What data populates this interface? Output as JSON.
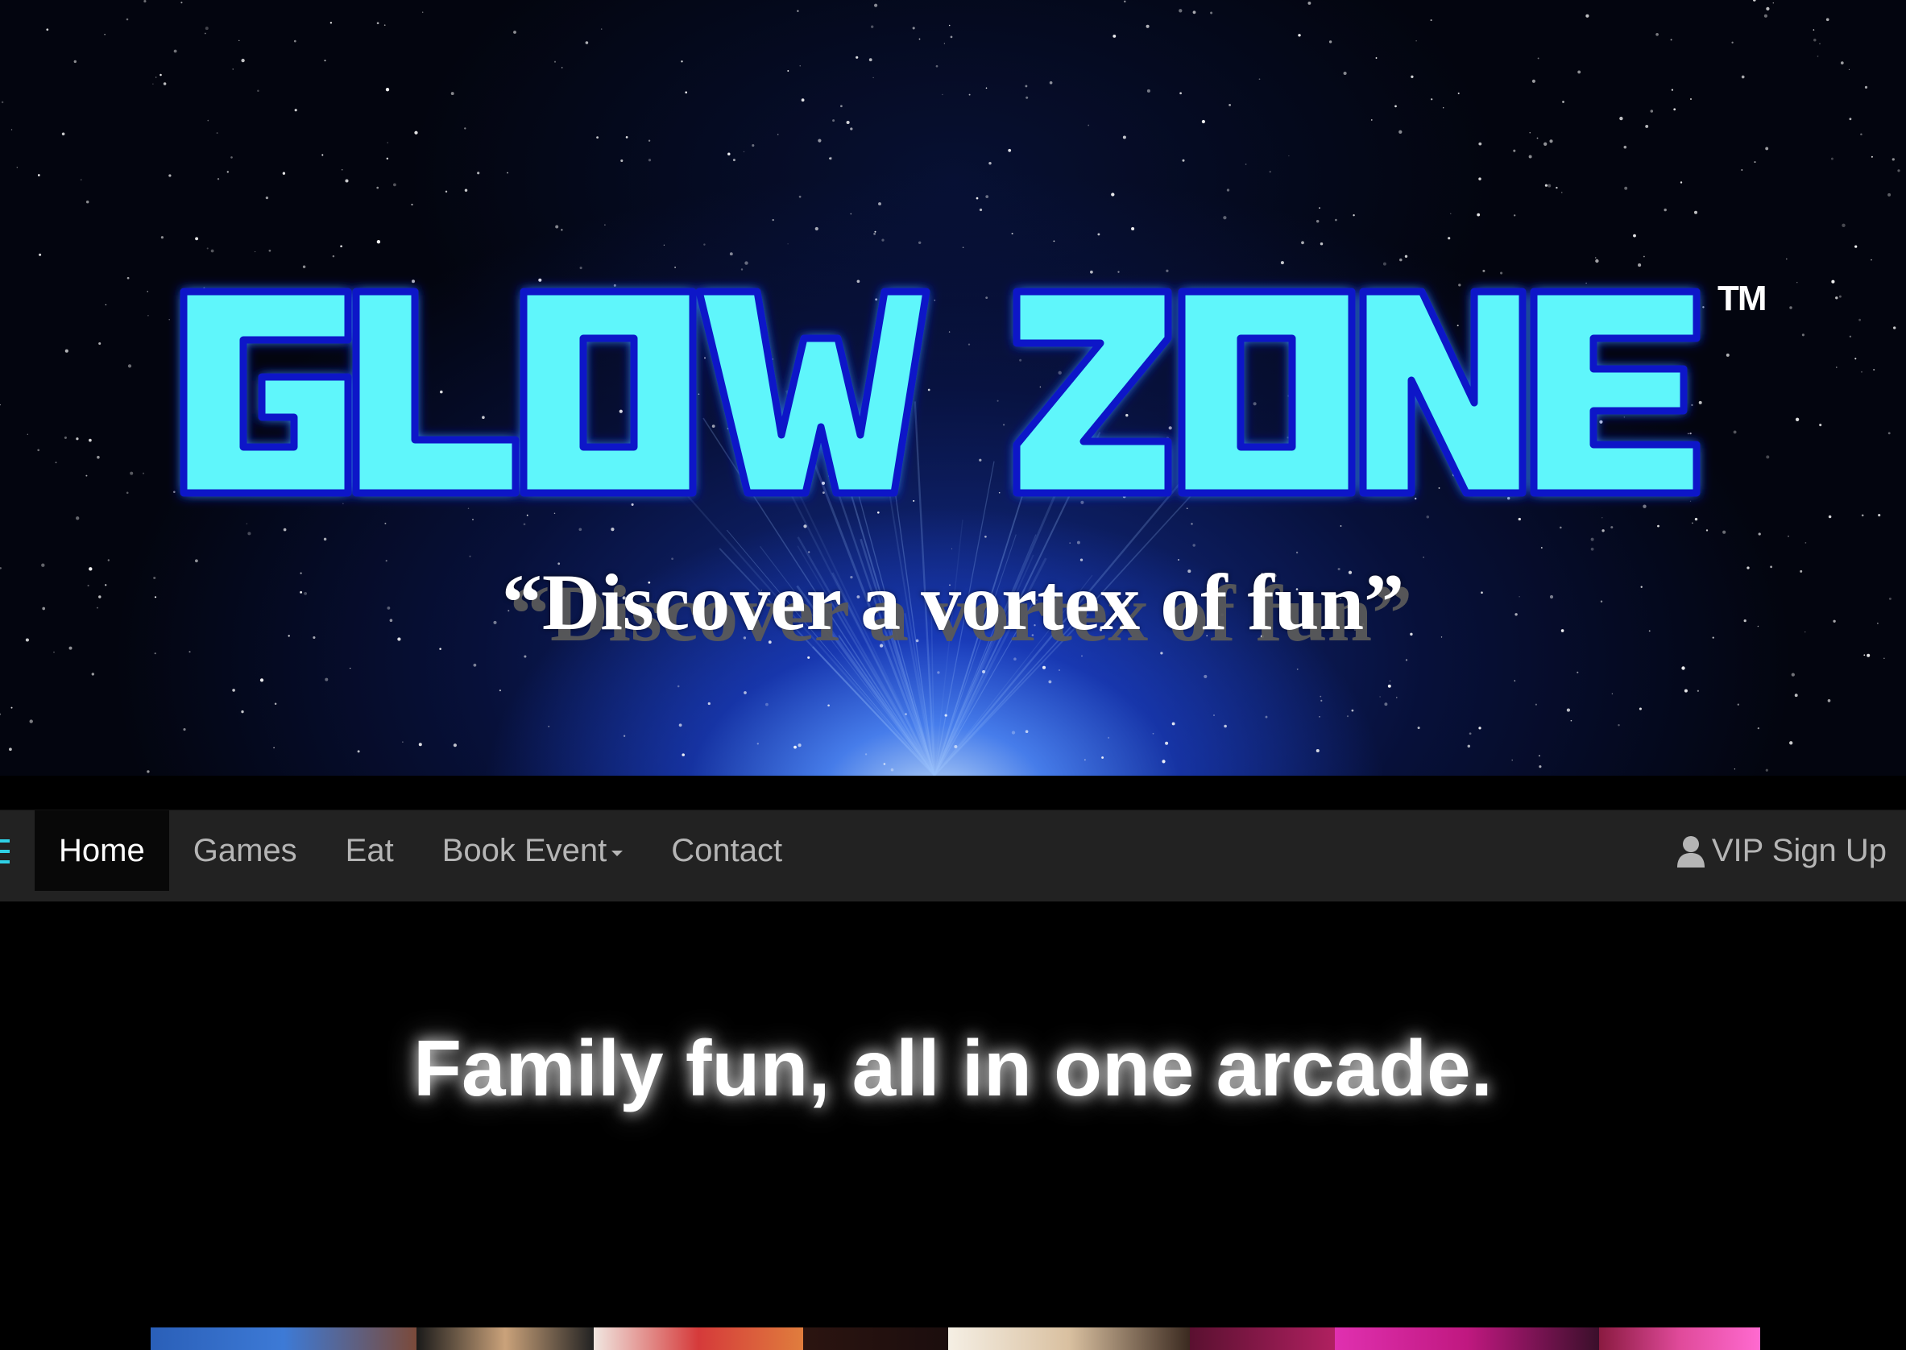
{
  "hero": {
    "logo_text": "GLOW ZONE",
    "trademark": "TM",
    "tagline": "“Discover a vortex of fun”"
  },
  "navbar": {
    "items": [
      {
        "label": "Home",
        "active": true
      },
      {
        "label": "Games",
        "active": false
      },
      {
        "label": "Eat",
        "active": false
      },
      {
        "label": "Book Event",
        "active": false,
        "dropdown": true
      },
      {
        "label": "Contact",
        "active": false
      }
    ],
    "vip_label": "VIP Sign Up",
    "vip_icon": "user-icon",
    "menu_icon": "hamburger-icon"
  },
  "main": {
    "headline": "Family fun, all in one arcade."
  },
  "colors": {
    "logo_fill": "#5ff6fb",
    "logo_outline": "#0a17c8",
    "navbar_bg": "#222222",
    "nav_active_bg": "#080808",
    "nav_text": "#b5b5b5",
    "accent": "#2fd1e6"
  }
}
